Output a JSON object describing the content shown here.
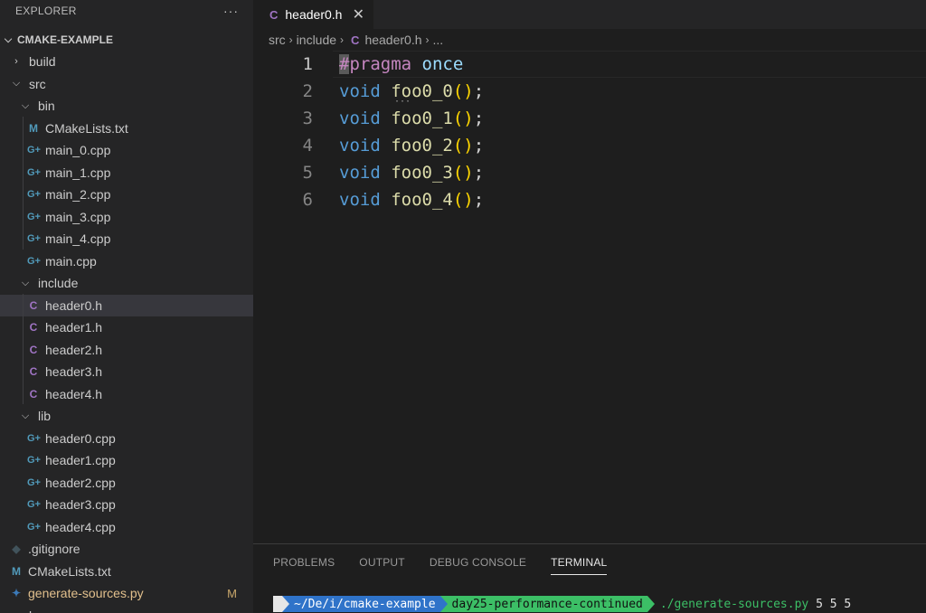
{
  "explorer": {
    "title": "EXPLORER",
    "more": "···",
    "project": "CMAKE-EXAMPLE",
    "items": [
      {
        "type": "folder",
        "label": "build",
        "open": false,
        "depth": 0
      },
      {
        "type": "folder",
        "label": "src",
        "open": true,
        "depth": 0
      },
      {
        "type": "folder",
        "label": "bin",
        "open": true,
        "depth": 1
      },
      {
        "type": "cmake",
        "label": "CMakeLists.txt",
        "depth": 2
      },
      {
        "type": "cpp",
        "label": "main_0.cpp",
        "depth": 2
      },
      {
        "type": "cpp",
        "label": "main_1.cpp",
        "depth": 2
      },
      {
        "type": "cpp",
        "label": "main_2.cpp",
        "depth": 2
      },
      {
        "type": "cpp",
        "label": "main_3.cpp",
        "depth": 2
      },
      {
        "type": "cpp",
        "label": "main_4.cpp",
        "depth": 2
      },
      {
        "type": "cpp",
        "label": "main.cpp",
        "depth": 2
      },
      {
        "type": "folder",
        "label": "include",
        "open": true,
        "depth": 1
      },
      {
        "type": "c",
        "label": "header0.h",
        "depth": 2,
        "selected": true
      },
      {
        "type": "c",
        "label": "header1.h",
        "depth": 2
      },
      {
        "type": "c",
        "label": "header2.h",
        "depth": 2
      },
      {
        "type": "c",
        "label": "header3.h",
        "depth": 2
      },
      {
        "type": "c",
        "label": "header4.h",
        "depth": 2
      },
      {
        "type": "folder",
        "label": "lib",
        "open": true,
        "depth": 1
      },
      {
        "type": "cpp",
        "label": "header0.cpp",
        "depth": 2
      },
      {
        "type": "cpp",
        "label": "header1.cpp",
        "depth": 2
      },
      {
        "type": "cpp",
        "label": "header2.cpp",
        "depth": 2
      },
      {
        "type": "cpp",
        "label": "header3.cpp",
        "depth": 2
      },
      {
        "type": "cpp",
        "label": "header4.cpp",
        "depth": 2
      },
      {
        "type": "git",
        "label": ".gitignore",
        "depth": 0
      },
      {
        "type": "cmake",
        "label": "CMakeLists.txt",
        "depth": 0
      },
      {
        "type": "py",
        "label": "generate-sources.py",
        "depth": 0,
        "badge": "M",
        "modified": true
      },
      {
        "type": "folder-cut",
        "label": "b...",
        "depth": 0
      }
    ]
  },
  "tab": {
    "icon": "C",
    "label": "header0.h",
    "close": "✕"
  },
  "breadcrumb": [
    "src",
    "include",
    "header0.h",
    "..."
  ],
  "breadcrumb_icon": "C",
  "code_lines": [
    {
      "num": "1",
      "tokens": [
        [
          "cursor-hl",
          "#"
        ],
        [
          "pp",
          "pragma"
        ],
        [
          "punc",
          " "
        ],
        [
          "ident",
          "once"
        ]
      ]
    },
    {
      "num": "2",
      "tokens": [
        [
          "kw",
          "void"
        ],
        [
          "punc",
          " "
        ],
        [
          "fn",
          "foo0_0"
        ],
        [
          "paren",
          "()"
        ],
        [
          "punc",
          ";"
        ]
      ]
    },
    {
      "num": "3",
      "tokens": [
        [
          "kw",
          "void"
        ],
        [
          "punc",
          " "
        ],
        [
          "fn",
          "foo0_1"
        ],
        [
          "paren",
          "()"
        ],
        [
          "punc",
          ";"
        ]
      ]
    },
    {
      "num": "4",
      "tokens": [
        [
          "kw",
          "void"
        ],
        [
          "punc",
          " "
        ],
        [
          "fn",
          "foo0_2"
        ],
        [
          "paren",
          "()"
        ],
        [
          "punc",
          ";"
        ]
      ]
    },
    {
      "num": "5",
      "tokens": [
        [
          "kw",
          "void"
        ],
        [
          "punc",
          " "
        ],
        [
          "fn",
          "foo0_3"
        ],
        [
          "paren",
          "()"
        ],
        [
          "punc",
          ";"
        ]
      ]
    },
    {
      "num": "6",
      "tokens": [
        [
          "kw",
          "void"
        ],
        [
          "punc",
          " "
        ],
        [
          "fn",
          "foo0_4"
        ],
        [
          "paren",
          "()"
        ],
        [
          "punc",
          ";"
        ]
      ]
    }
  ],
  "panel": {
    "tabs": [
      "PROBLEMS",
      "OUTPUT",
      "DEBUG CONSOLE",
      "TERMINAL"
    ],
    "active_tab": "TERMINAL"
  },
  "terminal": {
    "os_glyph": "",
    "dir": " ~/De/i/cmake-example",
    "git": "  day25-performance-continued",
    "command": "./generate-sources.py",
    "args": " 5 5 5"
  },
  "colors": {
    "accent_dir": "#2f73c9",
    "accent_git": "#3cbf66",
    "modified": "#e2c08d"
  }
}
